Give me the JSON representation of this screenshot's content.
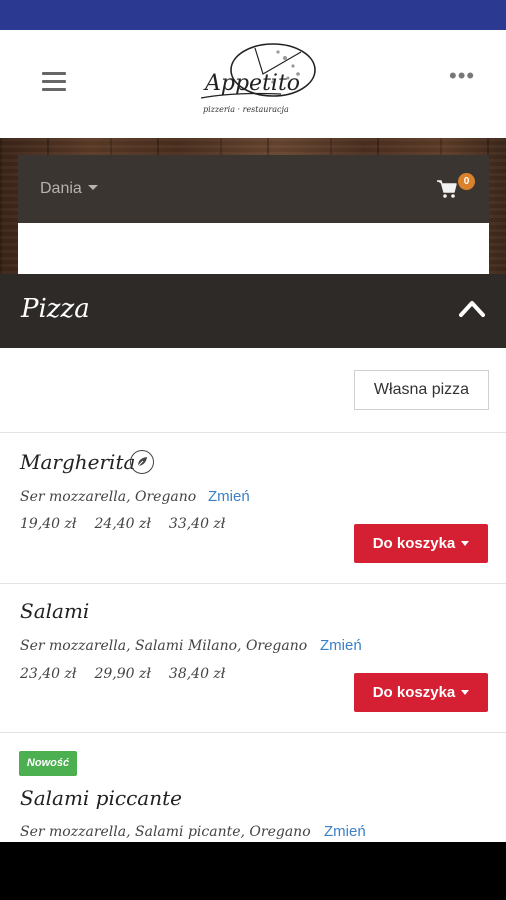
{
  "header": {
    "logo_text": "Appetito",
    "logo_subtitle": "pizzeria · restauracja"
  },
  "navbar": {
    "menu_label": "Dania",
    "cart_count": "0"
  },
  "category": {
    "title": "Pizza"
  },
  "own_pizza_label": "Własna pizza",
  "items": [
    {
      "name": "Margherita",
      "ingredients": "Ser mozzarella, Oregano",
      "change_label": "Zmień",
      "prices": [
        "19,40 zł",
        "24,40 zł",
        "33,40 zł"
      ],
      "add_label": "Do koszyka",
      "vegetarian": true
    },
    {
      "name": "Salami",
      "ingredients": "Ser mozzarella, Salami Milano, Oregano",
      "change_label": "Zmień",
      "prices": [
        "23,40 zł",
        "29,90 zł",
        "38,40 zł"
      ],
      "add_label": "Do koszyka"
    },
    {
      "badge": "Nowość",
      "name": "Salami piccante",
      "ingredients": "Ser mozzarella, Salami picante, Oregano",
      "change_label": "Zmień"
    }
  ],
  "colors": {
    "status_bar": "#2b3990",
    "category_bar": "#2d2a27",
    "add_button": "#d42032",
    "link": "#3b7fc4",
    "new_badge": "#4caf50",
    "cart_badge": "#d9822b"
  }
}
